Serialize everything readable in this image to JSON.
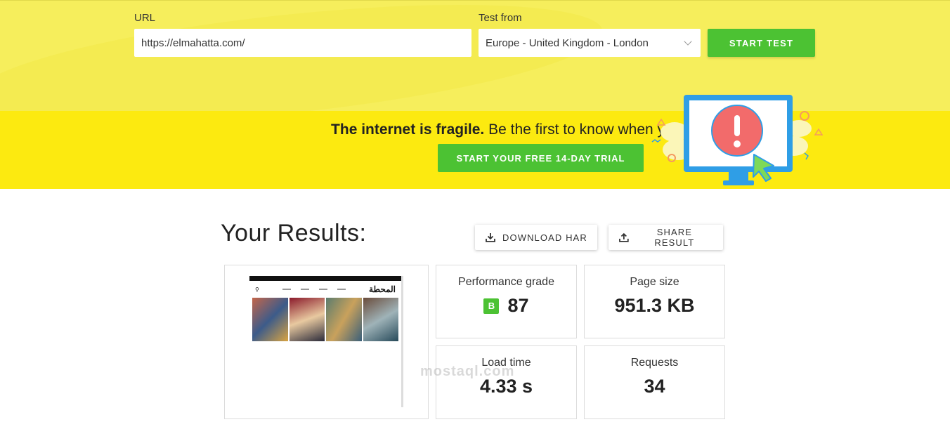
{
  "test_form": {
    "url_label": "URL",
    "url_value": "https://elmahatta.com/",
    "test_from_label": "Test from",
    "location_value": "Europe - United Kingdom - London",
    "start_button": "START TEST"
  },
  "banner": {
    "headline_bold": "The internet is fragile.",
    "headline_rest": " Be the first to know when your site is in danger.",
    "trial_button": "START YOUR FREE 14-DAY TRIAL"
  },
  "results": {
    "title": "Your Results:",
    "download_button": "DOWNLOAD HAR",
    "share_button": "SHARE RESULT",
    "metrics": {
      "performance_grade_label": "Performance grade",
      "grade_letter": "B",
      "grade_score": "87",
      "page_size_label": "Page size",
      "page_size_value": "951.3 KB",
      "load_time_label": "Load time",
      "load_time_value": "4.33 s",
      "requests_label": "Requests",
      "requests_value": "34"
    }
  },
  "thumbnail": {
    "site_logo": "المحطة"
  },
  "watermark": "mostaql.com",
  "colors": {
    "top_bg": "#f6ee5c",
    "banner_bg": "#fcea10",
    "accent_green": "#4cc233",
    "monitor_blue": "#2f9ee6",
    "alert_red": "#f26b6b"
  }
}
